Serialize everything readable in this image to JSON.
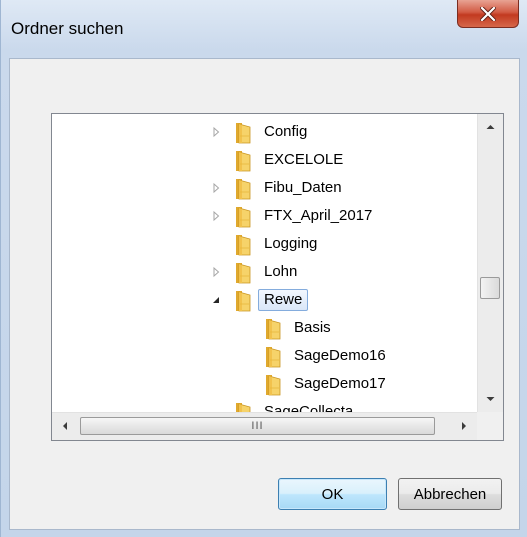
{
  "window": {
    "title": "Ordner suchen",
    "close_icon": "close-x-icon"
  },
  "tree": {
    "items": [
      {
        "label": "Config",
        "expander": "collapsed",
        "level": 0
      },
      {
        "label": "EXCELOLE",
        "expander": "none",
        "level": 0
      },
      {
        "label": "Fibu_Daten",
        "expander": "collapsed",
        "level": 0
      },
      {
        "label": "FTX_April_2017",
        "expander": "collapsed",
        "level": 0
      },
      {
        "label": "Logging",
        "expander": "none",
        "level": 0
      },
      {
        "label": "Lohn",
        "expander": "collapsed",
        "level": 0
      },
      {
        "label": "Rewe",
        "expander": "expanded",
        "level": 0,
        "selected": true
      },
      {
        "label": "Basis",
        "expander": "none",
        "level": 1
      },
      {
        "label": "SageDemo16",
        "expander": "none",
        "level": 1
      },
      {
        "label": "SageDemo17",
        "expander": "none",
        "level": 1
      },
      {
        "label": "SageCollecta",
        "expander": "none",
        "level": 0
      }
    ],
    "hscroll_thumb_grip": "III"
  },
  "buttons": {
    "ok": "OK",
    "cancel": "Abbrechen"
  },
  "colors": {
    "selection_border": "#84acdd",
    "folder_yellow": "#f2c24d",
    "close_red": "#c9452c"
  }
}
